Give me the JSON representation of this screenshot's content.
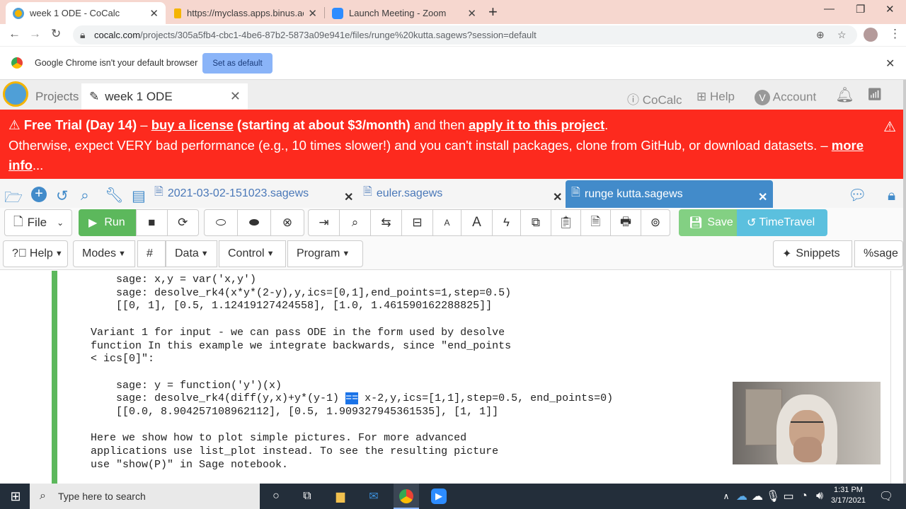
{
  "browser_tabs": [
    {
      "title": "week 1 ODE - CoCalc",
      "active": true
    },
    {
      "title": "https://myclass.apps.binus.ac.id/",
      "active": false
    },
    {
      "title": "Launch Meeting - Zoom",
      "active": false
    }
  ],
  "address": {
    "host": "cocalc.com",
    "path": "/projects/305a5fb4-cbc1-4be6-87b2-5873a09e941e/files/runge%20kutta.sagews?session=default"
  },
  "infobar": {
    "message": "Google Chrome isn't your default browser",
    "button": "Set as default"
  },
  "cocalc": {
    "projects": "Projects",
    "project_tab": "week 1 ODE",
    "cocalc": "CoCalc",
    "help": "Help",
    "account": "Account",
    "account_initial": "V"
  },
  "banner": {
    "free_trial": "Free Trial (Day 14)",
    "dash": " – ",
    "buy": "buy a license",
    "starting": " (starting at about $3/month) ",
    "and_then": "and then ",
    "apply": "apply it to this project",
    "period": ".",
    "line2": "Otherwise, expect VERY bad performance (e.g., 10 times slower!) and you can't install packages, clone from GitHub, or download datasets. – ",
    "more": "more",
    "info": "info",
    "ellipsis": "..."
  },
  "file_tabs": [
    {
      "name": "2021-03-02-151023.sagews"
    },
    {
      "name": "euler.sagews"
    },
    {
      "name": "runge kutta.sagews",
      "active": true
    }
  ],
  "toolbar": {
    "file": "File",
    "run": "Run",
    "save": "Save",
    "timetravel": "TimeTravel"
  },
  "menus": {
    "help": "Help",
    "modes": "Modes",
    "hash": "#",
    "data": "Data",
    "control": "Control",
    "program": "Program",
    "snippets": "Snippets",
    "mode": "%sage"
  },
  "code": {
    "l1": "    sage: x,y = var('x,y')",
    "l2": "    sage: desolve_rk4(x*y*(2-y),y,ics=[0,1],end_points=1,step=0.5)",
    "l3": "    [[0, 1], [0.5, 1.12419127424558], [1.0, 1.461590162288825]]",
    "l4": "",
    "l5": "Variant 1 for input - we can pass ODE in the form used by desolve",
    "l6": "function In this example we integrate backwards, since \"end_points",
    "l7": "< ics[0]\":",
    "l8": "",
    "l9": "    sage: y = function('y')(x)",
    "l10a": "    sage: desolve_rk4(diff(y,x)+y*(y-1) ",
    "l10sel": "==",
    "l10b": " x-2,y,ics=[1,1],step=0.5, end_points=0)",
    "l11": "    [[0.0, 8.904257108962112], [0.5, 1.909327945361535], [1, 1]]",
    "l12": "",
    "l13": "Here we show how to plot simple pictures. For more advanced",
    "l14": "applications use list_plot instead. To see the resulting picture",
    "l15": "use \"show(P)\" in Sage notebook."
  },
  "taskbar": {
    "search": "Type here to search",
    "time": "1:31 PM",
    "date": "3/17/2021"
  }
}
